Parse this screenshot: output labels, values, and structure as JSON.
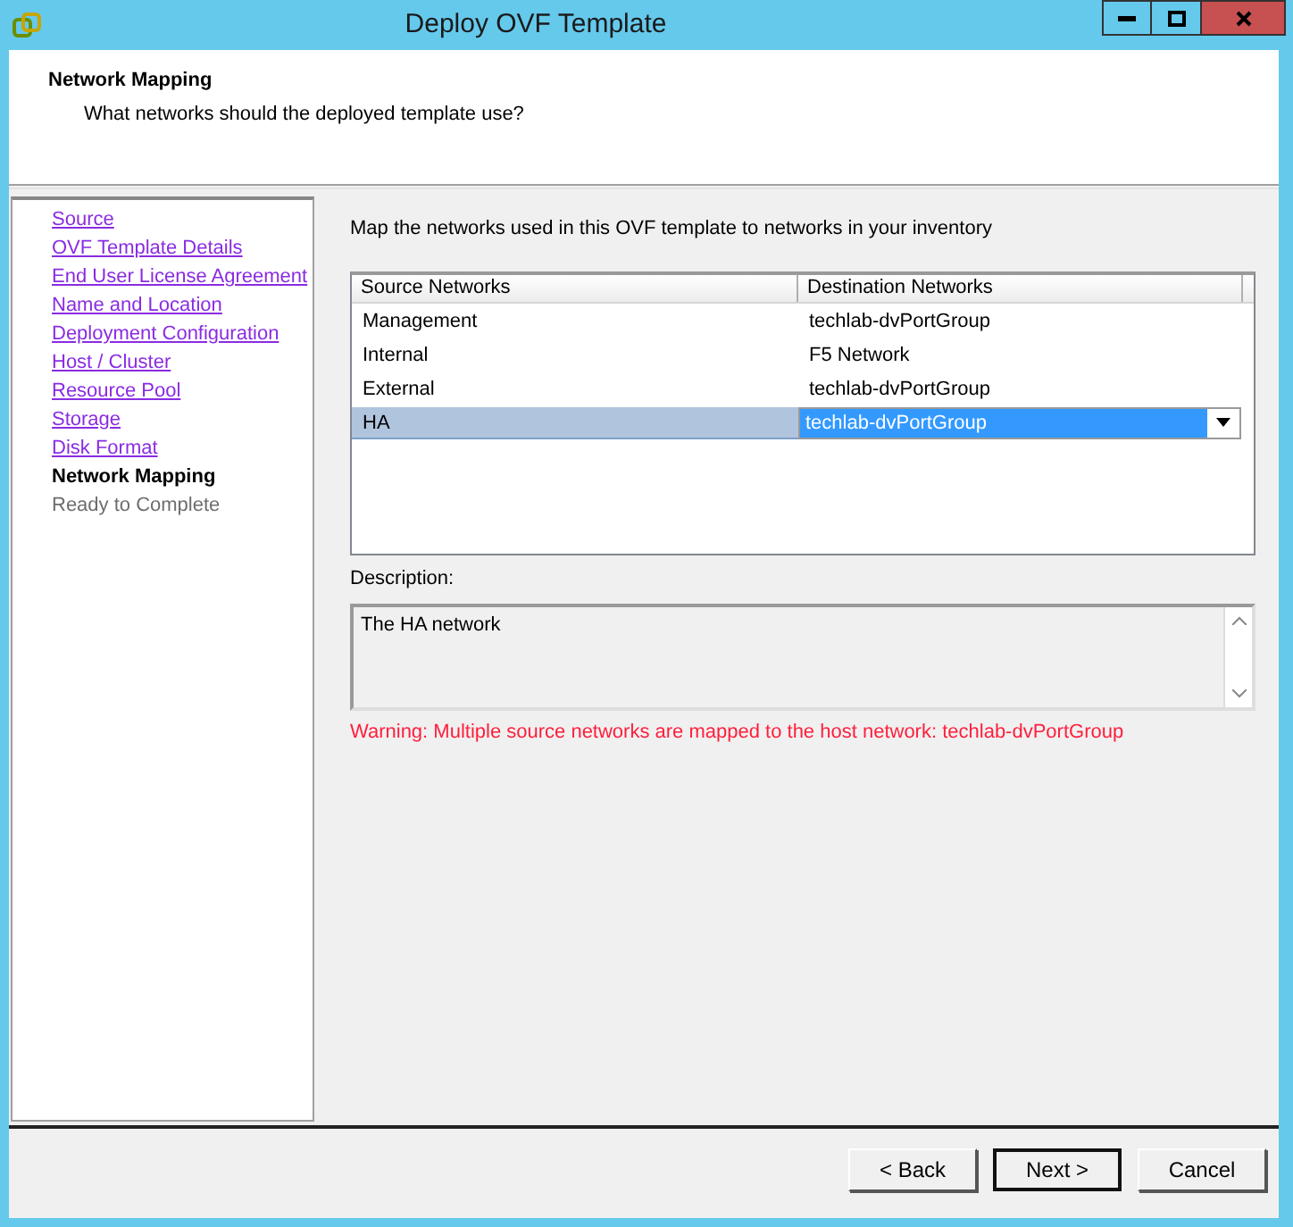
{
  "window": {
    "title": "Deploy OVF Template"
  },
  "header": {
    "title": "Network Mapping",
    "subtitle": "What networks should the deployed template use?"
  },
  "steps": [
    {
      "label": "Source",
      "kind": "done"
    },
    {
      "label": "OVF Template Details",
      "kind": "done"
    },
    {
      "label": "End User License Agreement",
      "kind": "done"
    },
    {
      "label": "Name and Location",
      "kind": "done"
    },
    {
      "label": "Deployment Configuration",
      "kind": "done"
    },
    {
      "label": "Host / Cluster",
      "kind": "done"
    },
    {
      "label": "Resource Pool",
      "kind": "done"
    },
    {
      "label": "Storage",
      "kind": "done"
    },
    {
      "label": "Disk Format",
      "kind": "done"
    },
    {
      "label": "Network Mapping",
      "kind": "current"
    },
    {
      "label": "Ready to Complete",
      "kind": "pending"
    }
  ],
  "intro": "Map the networks used in this OVF template to networks in your inventory",
  "table": {
    "columns": [
      "Source Networks",
      "Destination Networks"
    ],
    "rows": [
      {
        "source": "Management",
        "destination": "techlab-dvPortGroup",
        "selected": false
      },
      {
        "source": "Internal",
        "destination": "F5 Network",
        "selected": false
      },
      {
        "source": "External",
        "destination": "techlab-dvPortGroup",
        "selected": false
      },
      {
        "source": "HA",
        "destination": "techlab-dvPortGroup",
        "selected": true
      }
    ]
  },
  "description": {
    "label": "Description:",
    "text": "The HA network"
  },
  "warning": "Warning: Multiple source networks are mapped to the host network: techlab-dvPortGroup",
  "buttons": [
    {
      "label": "< Back",
      "default": false
    },
    {
      "label": "Next >",
      "default": true
    },
    {
      "label": "Cancel",
      "default": false
    }
  ]
}
